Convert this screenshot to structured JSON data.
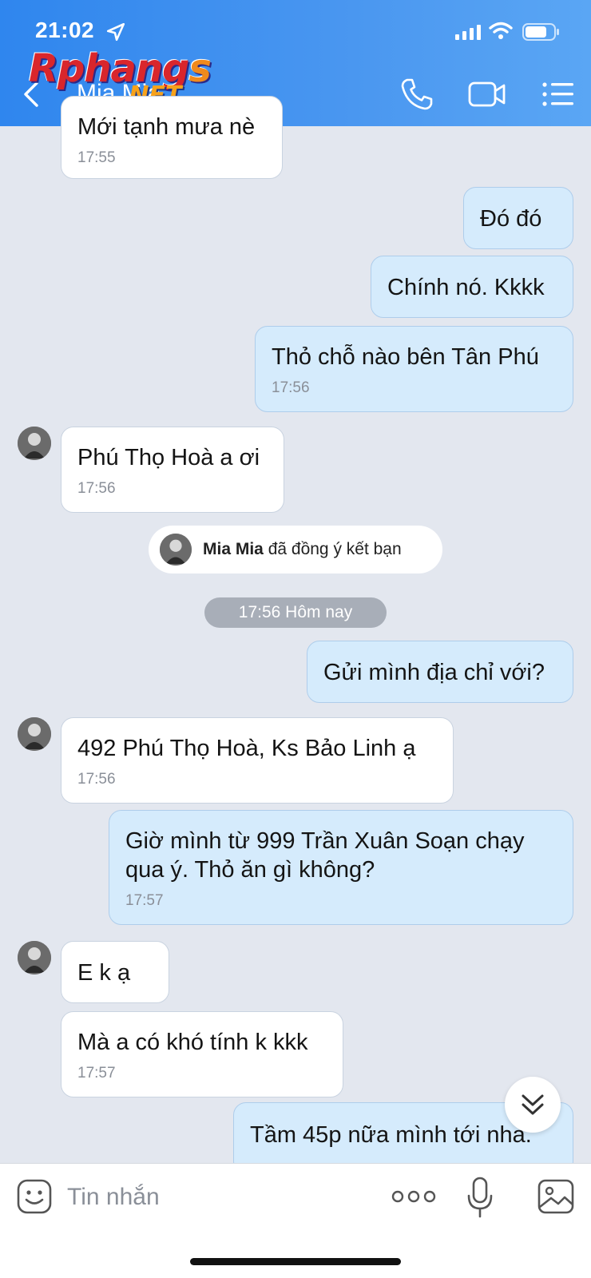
{
  "status_bar": {
    "time": "21:02"
  },
  "watermark": {
    "brand": "Rphang",
    "brand_tail": "s",
    "sub": ".NET"
  },
  "header": {
    "contact_name": "Mia Mia"
  },
  "messages": [
    {
      "direction": "in",
      "text": "Mới tạnh mưa nè",
      "time": "17:55"
    },
    {
      "direction": "out",
      "text": "Đó đó",
      "time": ""
    },
    {
      "direction": "out",
      "text": "Chính nó. Kkkk",
      "time": ""
    },
    {
      "direction": "out",
      "text": "Thỏ chỗ nào bên Tân Phú",
      "time": "17:56"
    },
    {
      "direction": "in",
      "text": "Phú Thọ Hoà a ơi",
      "time": "17:56"
    },
    {
      "direction": "out",
      "text": "Gửi mình địa chỉ với?",
      "time": ""
    },
    {
      "direction": "in",
      "text": "492 Phú Thọ Hoà, Ks Bảo Linh ạ",
      "time": "17:56"
    },
    {
      "direction": "out",
      "text_line1": "Giờ mình từ 999 Trần Xuân Soạn chạy",
      "text_line2": "qua ý. Thỏ ăn gì không?",
      "time": "17:57"
    },
    {
      "direction": "in",
      "text": "E k ạ",
      "time": ""
    },
    {
      "direction": "in",
      "text": "Mà a có khó tính k kkk",
      "time": "17:57"
    },
    {
      "direction": "out",
      "text": "Tầm 45p nữa mình tới nha.",
      "time": ""
    }
  ],
  "system_notice": {
    "name": "Mia Mia",
    "text": "đã đồng ý kết bạn"
  },
  "date_divider": "17:56 Hôm nay",
  "input": {
    "placeholder": "Tin nhắn"
  }
}
